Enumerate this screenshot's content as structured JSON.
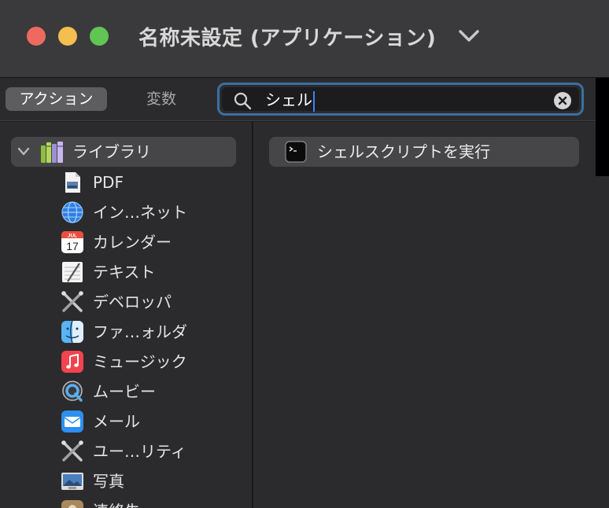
{
  "window": {
    "title": "名称未設定 (アプリケーション)"
  },
  "toolbar": {
    "actions_label": "アクション",
    "variables_label": "変数",
    "search_value": "シェル"
  },
  "sidebar": {
    "library_label": "ライブラリ",
    "categories": [
      {
        "label": "PDF",
        "icon": "pdf-icon"
      },
      {
        "label": "イン…ネット",
        "icon": "globe-icon"
      },
      {
        "label": "カレンダー",
        "icon": "calendar-icon",
        "icon_text": {
          "month": "JUL",
          "day": "17"
        }
      },
      {
        "label": "テキスト",
        "icon": "text-edit-icon"
      },
      {
        "label": "デベロッパ",
        "icon": "developer-tools-icon"
      },
      {
        "label": "ファ…ォルダ",
        "icon": "finder-icon"
      },
      {
        "label": "ミュージック",
        "icon": "music-icon"
      },
      {
        "label": "ムービー",
        "icon": "quicktime-icon"
      },
      {
        "label": "メール",
        "icon": "mail-icon"
      },
      {
        "label": "ユー…リティ",
        "icon": "utilities-icon"
      },
      {
        "label": "写真",
        "icon": "photos-icon"
      },
      {
        "label": "連絡先",
        "icon": "contacts-icon"
      }
    ]
  },
  "results": [
    {
      "label": "シェルスクリプトを実行",
      "icon": "terminal-icon"
    }
  ],
  "colors": {
    "close": "#ed6a5e",
    "minimize": "#f4bf4f",
    "maximize": "#61c554",
    "focus_ring": "#3a6fa0",
    "caret": "#3c82f6"
  }
}
